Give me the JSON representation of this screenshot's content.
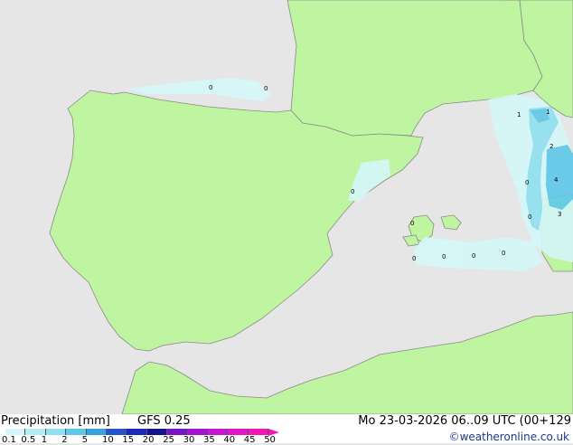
{
  "footer": {
    "title": "Precipitation [mm]",
    "model": "GFS 0.25",
    "datetime": "Mo 23-03-2026 06..09 UTC (00+129",
    "credit": "©weatheronline.co.uk"
  },
  "legend": {
    "ticks": [
      "0.1",
      "0.5",
      "1",
      "2",
      "5",
      "10",
      "15",
      "20",
      "25",
      "30",
      "35",
      "40",
      "45",
      "50"
    ],
    "colors": [
      "#d4f7f9",
      "#b4eef5",
      "#8fe1f0",
      "#5fc8ea",
      "#3aa3dd",
      "#2255cc",
      "#1c28b8",
      "#14128f",
      "#7a14c8",
      "#a214d0",
      "#c814d4",
      "#e414c8",
      "#f514b4"
    ]
  },
  "map_labels": [
    {
      "value": "0"
    },
    {
      "value": "0"
    },
    {
      "value": "0"
    },
    {
      "value": "1"
    },
    {
      "value": "1"
    },
    {
      "value": "2"
    },
    {
      "value": "0"
    },
    {
      "value": "4"
    },
    {
      "value": "0"
    },
    {
      "value": "3"
    },
    {
      "value": "0"
    },
    {
      "value": "0"
    },
    {
      "value": "0"
    },
    {
      "value": "0"
    },
    {
      "value": "0"
    }
  ],
  "colors": {
    "land": "#bff5a0",
    "sea": "#e6e6e6",
    "border": "#8a8a8a"
  }
}
